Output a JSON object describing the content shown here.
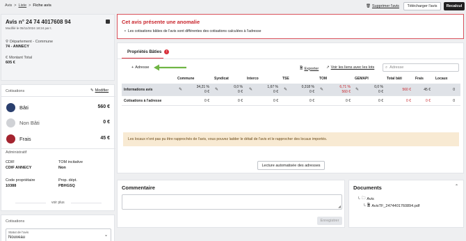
{
  "breadcrumb": {
    "home": "Avis",
    "sep1": ">",
    "list": "Liste",
    "sep2": ">",
    "current": "Fiche avis"
  },
  "top_actions": {
    "delete": "Supprimer l'avis",
    "download": "Télécharger l'avis",
    "recalc": "Recalcul"
  },
  "avis": {
    "title": "Avis n° 24 74 4017608 94",
    "modified": "Modifié le 05/11/2024 18:24 par t.",
    "dept_label": "Département - Commune",
    "dept_value": "74 - ANNECY",
    "montant_label": "Montant Total",
    "montant_value": "605 €"
  },
  "cotisations": {
    "title": "Cotisations",
    "modify": "Modifier",
    "items": [
      {
        "label": "Bâti",
        "value": "560 €",
        "color": "#2a3f6e"
      },
      {
        "label": "Non Bâti",
        "value": "0 €",
        "color": "#d0d2d6"
      },
      {
        "label": "Frais",
        "value": "45 €",
        "color": "#a4242f"
      }
    ]
  },
  "administratif": {
    "title": "Administratif",
    "fields": [
      {
        "label": "CDIF",
        "value": "CDIF ANNECY"
      },
      {
        "label": "TOM incitative",
        "value": "Non"
      },
      {
        "label": "Code propriétaire",
        "value": "10388"
      },
      {
        "label": "Prop. dépt.",
        "value": "PBHGSQ"
      }
    ],
    "see_more": "voir plus"
  },
  "cotisations2": {
    "title": "Cotisations",
    "status_label": "Statut de l'avis",
    "status_value": "Nouveau"
  },
  "anomaly": {
    "title": "Cet avis présente une anomalie",
    "message": "Les cotisations bâties de l'avis sont différentes des cotisations calculées à l'adresse"
  },
  "tabs": [
    {
      "label": "Propriétés Bâties",
      "badge": "!"
    }
  ],
  "toolbar": {
    "address": "Adresse",
    "export": "Exporter",
    "links": "Voir les liens avec les lots",
    "search_placeholder": "Adresse"
  },
  "table": {
    "headers": [
      "Commune",
      "Syndicat",
      "Interco",
      "TSE",
      "TOM",
      "GEMAPI",
      "Total bâti",
      "Frais",
      "Locaux"
    ],
    "rows": [
      {
        "label": "Informations avis",
        "commune": [
          "34,21 %",
          "0 €"
        ],
        "syndicat": [
          "0,0 %",
          "0 €"
        ],
        "interco": [
          "1,67 %",
          "0 €"
        ],
        "tse": [
          "0,318 %",
          "0 €"
        ],
        "tom": [
          "6,71 %",
          "560 €"
        ],
        "gemapi": [
          "0,0 %",
          "0 €"
        ],
        "total": "560 €",
        "frais": "45 €",
        "locaux": "0"
      },
      {
        "label": "Cotisations à l'adresse",
        "commune": "0 €",
        "syndicat": "0 €",
        "interco": "0 €",
        "tse": "0 €",
        "tom": "0 €",
        "gemapi": "0 €",
        "total": "0 €",
        "frais": "0 €",
        "locaux": "0"
      }
    ]
  },
  "info_banner": "Les locaux n'ont pas pu être rapprochés de l'avis, vous pouvez ladder le détail de l'avis et le rapprocher des locaux importés.",
  "auto_read": "Lecture automatisée des adresses",
  "comment": {
    "title": "Commentaire",
    "save": "Enregistrer"
  },
  "documents": {
    "title": "Documents",
    "folder": "Avis",
    "file": "AvisTF_2474401760894.pdf"
  },
  "colors": {
    "accent_green": "#6fb544",
    "anomaly_red": "#c8242b",
    "banner_bg": "#f8ead3"
  }
}
